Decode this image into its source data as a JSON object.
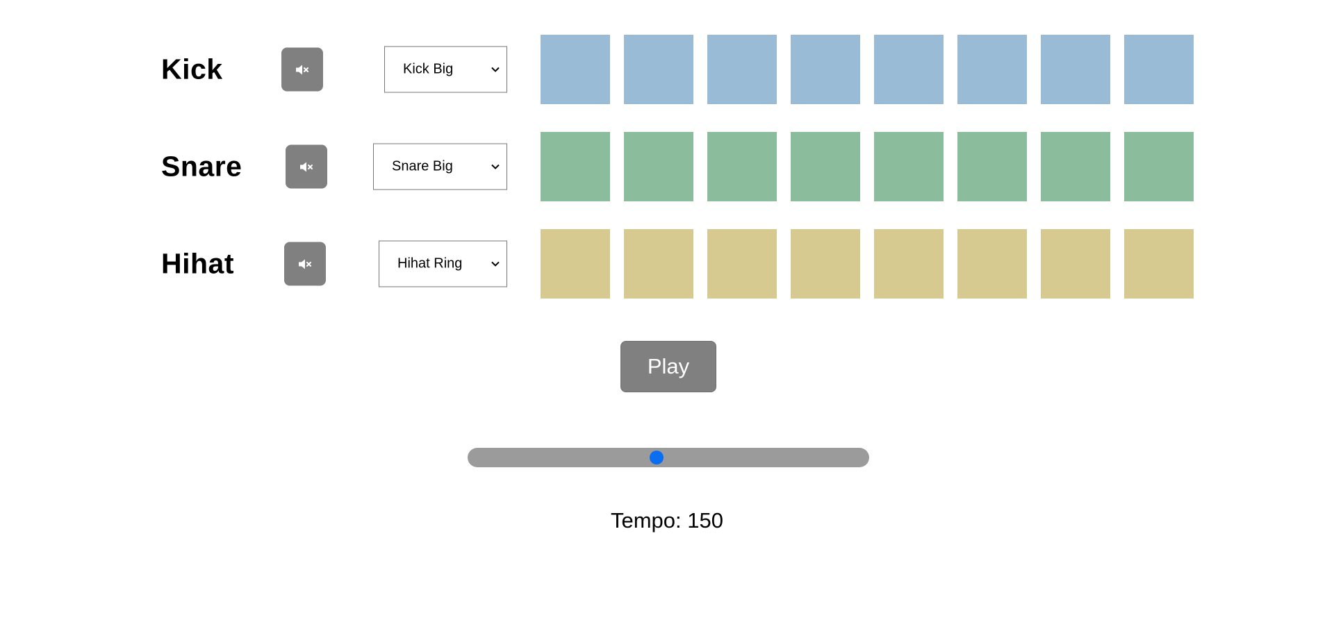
{
  "tracks": [
    {
      "name": "Kick",
      "mute_icon": "mute-icon",
      "sound": "Kick Big",
      "pad_color": "#99bbd6",
      "pads_active": [
        false,
        false,
        false,
        false,
        false,
        false,
        false,
        false
      ]
    },
    {
      "name": "Snare",
      "mute_icon": "mute-icon",
      "sound": "Snare Big",
      "pad_color": "#8bbc9c",
      "pads_active": [
        false,
        false,
        false,
        false,
        false,
        false,
        false,
        false
      ]
    },
    {
      "name": "Hihat",
      "mute_icon": "mute-icon",
      "sound": "Hihat Ring",
      "pad_color": "#d7ca91",
      "pads_active": [
        false,
        false,
        false,
        false,
        false,
        false,
        false,
        false
      ]
    }
  ],
  "controls": {
    "play_label": "Play",
    "tempo_label": "Tempo:",
    "tempo_value": "150",
    "tempo_slider_fraction": 0.47
  },
  "colors": {
    "button_bg": "#808080",
    "slider_track": "#9b9b9b",
    "slider_thumb": "#0a6ef0"
  }
}
